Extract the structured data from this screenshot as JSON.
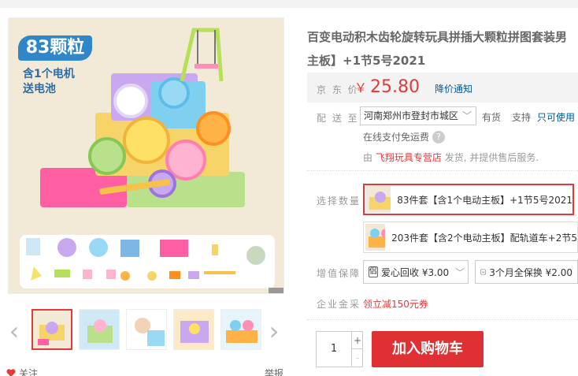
{
  "gallery": {
    "badge": "83颗粒",
    "promo_line1": "含1个电机",
    "promo_line2": "送电池",
    "parts": [
      "×1",
      "×5",
      "×8",
      "×24",
      "×1",
      "×1",
      "×1",
      "×1",
      "×1",
      "×3",
      "×3",
      "×20",
      "×5",
      "×1",
      "×4",
      "×1",
      "×2",
      "×1"
    ]
  },
  "follow_label": "关注",
  "report_label": "举报",
  "product": {
    "title_line1": "百变电动积木齿轮旋转玩具拼插大颗粒拼图套装男",
    "title_line2": "主板】+1节5号2021"
  },
  "price": {
    "label": "京 东 价",
    "currency": "￥",
    "value": "25.80",
    "notice": "降价通知"
  },
  "delivery": {
    "label": "配 送 至",
    "address": "河南郑州市登封市城区",
    "stock": "有货",
    "support_label": "支持",
    "support_link": "只可使用",
    "free_shipping": "在线支付免运费",
    "seller_prefix": "由",
    "seller_shop": "飞翔玩具专营店",
    "seller_suffix": "发货, 并提供售后服务."
  },
  "options": {
    "label": "选择数量",
    "items": [
      {
        "text": "83件套【含1个电动主板】+1节5号2021",
        "selected": true
      },
      {
        "text": "203件套【含2个电动主板】配轨道车+2节5",
        "selected": false
      }
    ]
  },
  "services": {
    "label": "增值保障",
    "items": [
      {
        "text": "爱心回收 ¥3.00"
      },
      {
        "text": "3个月全保换 ¥2.00"
      }
    ]
  },
  "enterprise": {
    "label": "企业金采",
    "coupon": "领立减150元券"
  },
  "purchase": {
    "quantity": "1",
    "plus": "+",
    "minus": "-",
    "cart_button": "加入购物车"
  },
  "colors": {
    "accent_red": "#e4393c",
    "link_blue": "#005aa0",
    "badge_blue": "#2f86c8"
  }
}
